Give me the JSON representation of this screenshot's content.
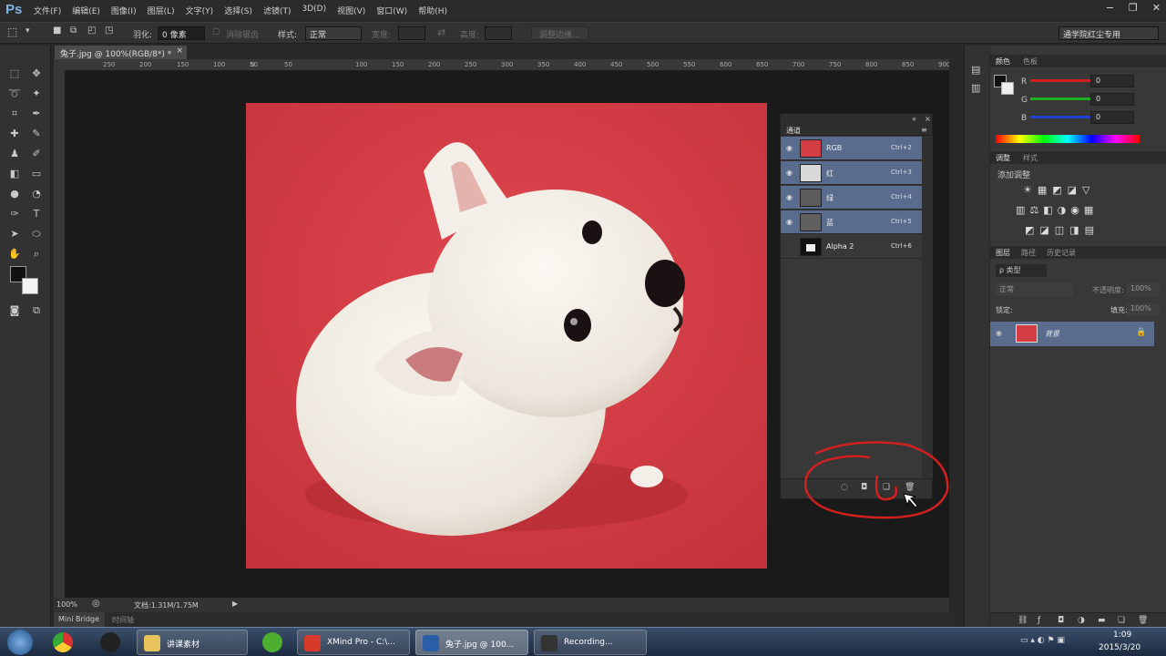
{
  "app": {
    "logo": "Ps",
    "menus": [
      "文件(F)",
      "编辑(E)",
      "图像(I)",
      "图层(L)",
      "文字(Y)",
      "选择(S)",
      "滤镜(T)",
      "3D(D)",
      "视图(V)",
      "窗口(W)",
      "帮助(H)"
    ],
    "window_controls": [
      "−",
      "❐",
      "✕"
    ]
  },
  "options_bar": {
    "feather_label": "羽化:",
    "feather_value": "0 像素",
    "antialias_label": "消除锯齿",
    "style_label": "样式:",
    "style_value": "正常",
    "width_label": "宽度:",
    "height_label": "高度:",
    "refine_edge_button": "调整边缘...",
    "workspace": "通学院红尘专用"
  },
  "document": {
    "tab_title": "兔子.jpg @ 100%(RGB/8*) *",
    "zoom": "100%",
    "doc_info": "文档:1.31M/1.75M",
    "ruler_ticks": [
      "250",
      "200",
      "150",
      "100",
      "50",
      "0",
      "50",
      "100",
      "150",
      "200",
      "250",
      "300",
      "350",
      "400",
      "450",
      "500",
      "550",
      "600",
      "650",
      "700",
      "750",
      "800",
      "850",
      "900",
      "95"
    ]
  },
  "bottom_tabs": [
    "Mini Bridge",
    "时间轴"
  ],
  "channels_panel": {
    "title": "通道",
    "rows": [
      {
        "name": "RGB",
        "shortcut": "Ctrl+2",
        "visible": true,
        "selected": true
      },
      {
        "name": "红",
        "shortcut": "Ctrl+3",
        "visible": true,
        "selected": true
      },
      {
        "name": "绿",
        "shortcut": "Ctrl+4",
        "visible": true,
        "selected": true
      },
      {
        "name": "蓝",
        "shortcut": "Ctrl+5",
        "visible": true,
        "selected": true
      },
      {
        "name": "Alpha 2",
        "shortcut": "Ctrl+6",
        "visible": false,
        "selected": false
      }
    ],
    "footer_icons": [
      "load-selection-icon",
      "save-selection-icon",
      "new-channel-icon",
      "delete-channel-icon"
    ]
  },
  "color_panel": {
    "tabs": [
      "颜色",
      "色板"
    ],
    "channels": [
      {
        "label": "R",
        "value": "0",
        "color": "#d02020"
      },
      {
        "label": "G",
        "value": "0",
        "color": "#20b020"
      },
      {
        "label": "B",
        "value": "0",
        "color": "#2040d0"
      }
    ]
  },
  "adjustments_panel": {
    "tabs": [
      "调整",
      "样式"
    ],
    "add_label": "添加调整"
  },
  "layers_panel": {
    "tabs": [
      "图层",
      "路径",
      "历史记录"
    ],
    "filter_label": "ρ 类型",
    "blend_mode": "正常",
    "opacity_label": "不透明度:",
    "opacity_value": "100%",
    "lock_label": "锁定:",
    "fill_label": "填充:",
    "fill_value": "100%",
    "layers": [
      {
        "name": "背景",
        "locked": true
      }
    ]
  },
  "taskbar": {
    "items": [
      {
        "label": "讲课素材",
        "icon": "folder-icon",
        "color": "#e8c25a"
      },
      {
        "label": "XMind Pro - C:\\...",
        "icon": "xmind-icon",
        "color": "#d63a2a"
      },
      {
        "label": "兔子.jpg @ 100...",
        "icon": "photoshop-icon",
        "color": "#2a5fa8"
      },
      {
        "label": "Recording...",
        "icon": "recorder-icon",
        "color": "#333333"
      }
    ],
    "clock_time": "1:09",
    "clock_date": "2015/3/20"
  }
}
